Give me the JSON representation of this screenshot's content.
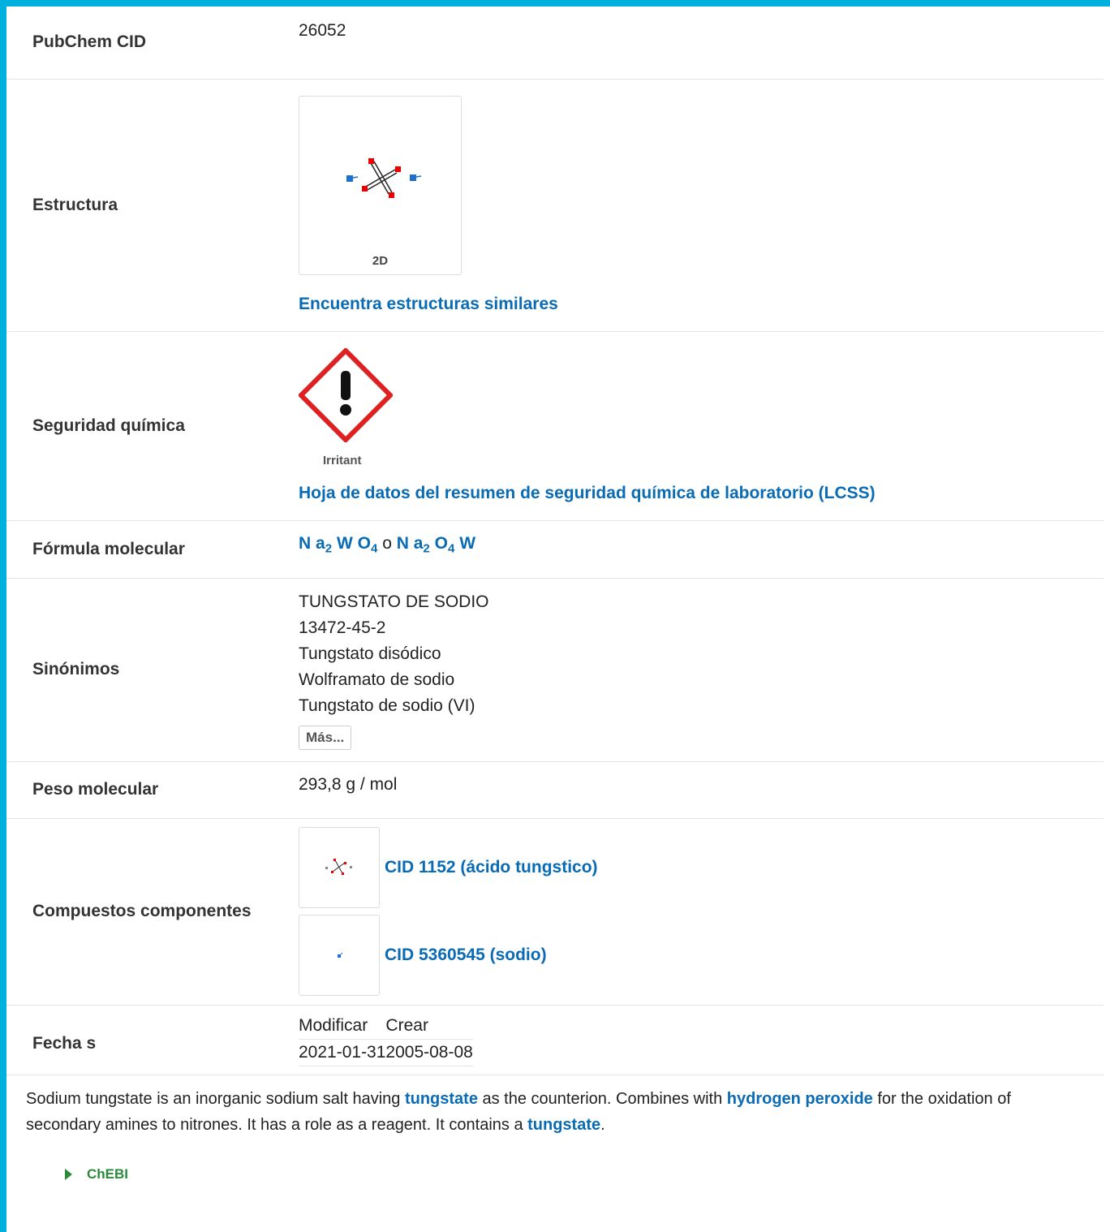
{
  "summary": {
    "cid": {
      "label": "PubChem CID",
      "value": "26052"
    },
    "structure": {
      "label": "Estructura",
      "thumb_caption": "2D",
      "similar_link": "Encuentra estructuras similares"
    },
    "safety": {
      "label": "Seguridad química",
      "pictogram_label": "Irritant",
      "lcss_link": "Hoja de datos del resumen de seguridad química de laboratorio (LCSS)"
    },
    "formula": {
      "label": "Fórmula molecular",
      "f1": {
        "a": "N a",
        "s1": "2",
        "b": "W O",
        "s2": "4"
      },
      "conj": "o",
      "f2": {
        "a": "N a",
        "s1": "2",
        "b": "O",
        "s2": "4",
        "c": "W"
      }
    },
    "synonyms": {
      "label": "Sinónimos",
      "items": [
        "TUNGSTATO DE SODIO",
        "13472-45-2",
        "Tungstato disódico",
        "Wolframato de sodio",
        "Tungstato de sodio (VI)"
      ],
      "more_button": "Más..."
    },
    "weight": {
      "label": "Peso molecular",
      "value": "293,8 g / mol"
    },
    "components": {
      "label": "Compuestos componentes",
      "items": [
        {
          "link": "CID 1152 (ácido tungstico)"
        },
        {
          "link": "CID 5360545 (sodio)"
        }
      ]
    },
    "dates": {
      "label": "Fecha s",
      "modify_label": "Modificar",
      "create_label": "Crear",
      "modify_value": "2021-01-31",
      "create_value": "2005-08-08"
    }
  },
  "description": {
    "t1": "Sodium tungstate is an inorganic sodium salt having ",
    "l1": "tungstate",
    "t2": " as the counterion. Combines with ",
    "l2": "hydrogen peroxide",
    "t3": " for the oxidation of secondary amines to nitrones. It has a role as a reagent. It contains a ",
    "l3": "tungstate",
    "t4": "."
  },
  "source": {
    "label": "ChEBI"
  },
  "colors": {
    "accent_border": "#00b1e0",
    "link": "#0a6bb5",
    "source_green": "#2a8a3a",
    "ghs_red": "#e02020"
  }
}
